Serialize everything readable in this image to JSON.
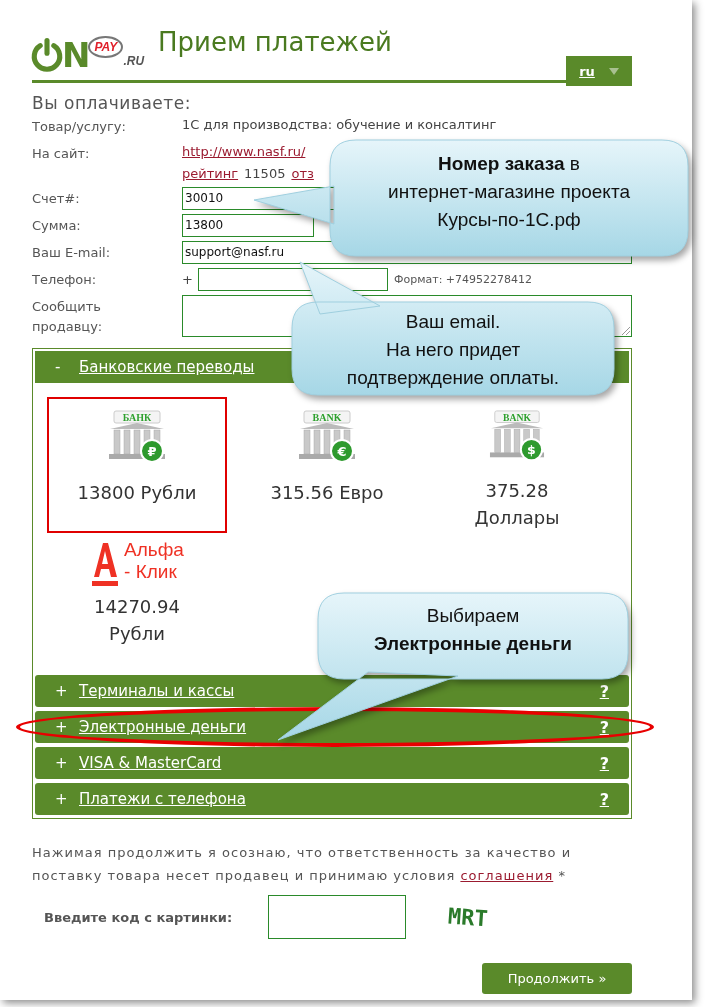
{
  "header": {
    "logo": {
      "letter": "N",
      "badge": "PAY",
      "domain": ".RU"
    },
    "title": "Прием платежей",
    "language": "ru"
  },
  "paying_heading": "Вы оплачиваете:",
  "fields": [
    {
      "kind": "text",
      "label": "Товар/услугу:",
      "value": "1С для производства: обучение и консалтинг"
    },
    {
      "kind": "site",
      "label": "На сайт:",
      "link": "http://www.nasf.ru/",
      "rating_link": "рейтинг",
      "rating": "11505",
      "reviews_link": "отз"
    },
    {
      "kind": "input",
      "label": "Счет#:",
      "value": "30010"
    },
    {
      "kind": "amount",
      "label": "Сумма:",
      "value": "13800"
    },
    {
      "kind": "input",
      "label": "Ваш E-mail:",
      "value": "support@nasf.ru"
    },
    {
      "kind": "phone",
      "label": "Телефон:",
      "prefix": "+",
      "hint": "Формат: +74952278412"
    },
    {
      "kind": "textarea",
      "label": "Сообщить продавцу:"
    }
  ],
  "payment_groups": [
    {
      "label": "Банковские переводы",
      "toggle": "-",
      "expanded": true,
      "highlighted": false,
      "options": [
        {
          "kind": "bank",
          "sign": "БАНК",
          "symbol": "₽",
          "amount": "13800 Рубли",
          "selected": true
        },
        {
          "kind": "bank",
          "sign": "BANK",
          "symbol": "€",
          "amount": "315.56 Евро",
          "selected": false
        },
        {
          "kind": "bank",
          "sign": "BANK",
          "symbol": "$",
          "amount": "375.28 Доллары",
          "selected": false
        },
        {
          "kind": "alfa",
          "logo_top": "Альфа",
          "logo_bottom": "- Клик",
          "amount": "14270.94 Рубли",
          "selected": false
        }
      ]
    },
    {
      "label": "Терминалы и кассы",
      "toggle": "+",
      "expanded": false,
      "highlighted": false,
      "help": "?"
    },
    {
      "label": "Электронные деньги",
      "toggle": "+",
      "expanded": false,
      "highlighted": true,
      "help": "?"
    },
    {
      "label": "VISA & MasterCard",
      "toggle": "+",
      "expanded": false,
      "highlighted": false,
      "help": "?"
    },
    {
      "label": "Платежи с телефона",
      "toggle": "+",
      "expanded": false,
      "highlighted": false,
      "help": "?"
    }
  ],
  "agreement": {
    "text": "Нажимая продолжить я осознаю, что ответственность за качество и поставку товара несет продавец и принимаю условия",
    "link": "соглашения",
    "mark": "*"
  },
  "captcha": {
    "label": "Введите код с картинки:",
    "image_text": "MRT"
  },
  "submit": "Продолжить »",
  "callouts": [
    {
      "lines": [
        "**Номер заказа** в",
        "интернет-магазине проекта",
        "Курсы-по-1С.рф"
      ]
    },
    {
      "lines": [
        "Ваш email.",
        "На него придет",
        "подтверждение оплаты."
      ]
    },
    {
      "lines": [
        "Выбираем",
        "**Электронные деньги**"
      ]
    }
  ]
}
